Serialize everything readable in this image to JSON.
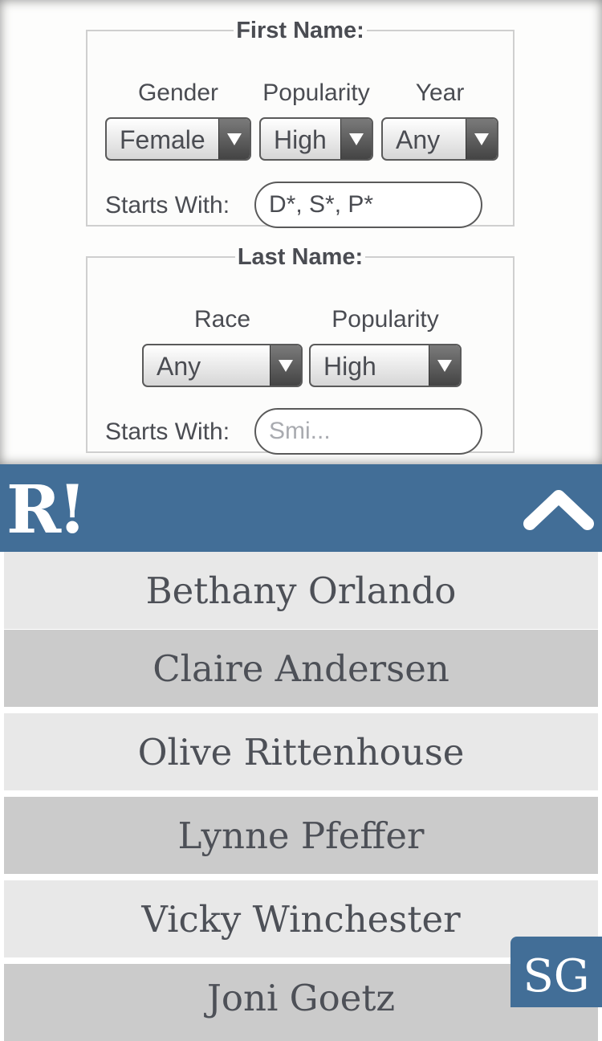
{
  "first_name": {
    "legend": "First Name:",
    "gender": {
      "label": "Gender",
      "value": "Female"
    },
    "popularity": {
      "label": "Popularity",
      "value": "High"
    },
    "year": {
      "label": "Year",
      "value": "Any"
    },
    "starts_with": {
      "label": "Starts With:",
      "value": "D*, S*, P*"
    }
  },
  "last_name": {
    "legend": "Last Name:",
    "race": {
      "label": "Race",
      "value": "Any"
    },
    "popularity": {
      "label": "Popularity",
      "value": "High"
    },
    "starts_with": {
      "label": "Starts With:",
      "placeholder": "Smi..."
    }
  },
  "header": {
    "logo": "R!",
    "collapse_icon": "chevron-up-icon"
  },
  "results": [
    "Bethany Orlando",
    "Claire Andersen",
    "Olive Rittenhouse",
    "Lynne Pfeffer",
    "Vicky Winchester",
    "Joni Goetz"
  ],
  "badge": "SG",
  "colors": {
    "header_bg": "#426e97",
    "row_light": "#e8e8e8",
    "row_dark": "#cbcbcb",
    "text": "#4a4c52"
  }
}
